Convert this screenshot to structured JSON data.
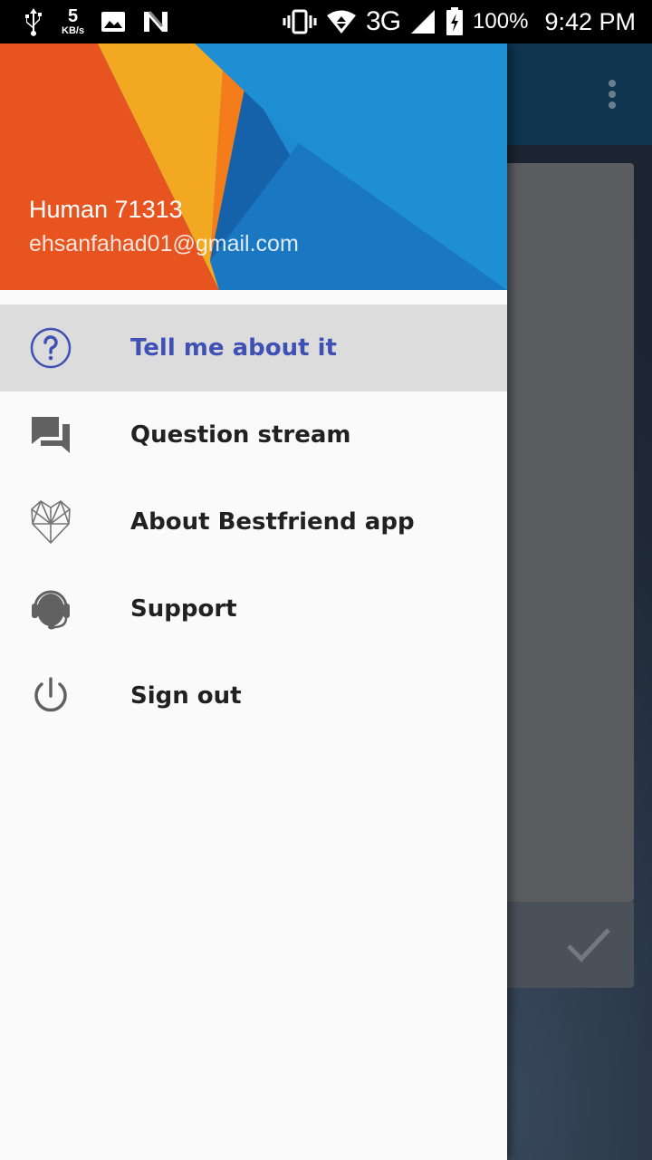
{
  "status_bar": {
    "network_speed_value": "5",
    "network_speed_unit": "KB/s",
    "network_type": "3G",
    "battery_percent": "100%",
    "time": "9:42 PM"
  },
  "drawer": {
    "user": {
      "name": "Human 71313",
      "email": "ehsanfahad01@gmail.com"
    },
    "items": [
      {
        "label": "Tell me about it",
        "icon": "help-circle-icon",
        "active": true
      },
      {
        "label": "Question stream",
        "icon": "forum-icon",
        "active": false
      },
      {
        "label": "About Bestfriend app",
        "icon": "heart-logo-icon",
        "active": false
      },
      {
        "label": "Support",
        "icon": "headset-icon",
        "active": false
      },
      {
        "label": "Sign out",
        "icon": "power-icon",
        "active": false
      }
    ]
  },
  "colors": {
    "active_item_text": "#3f51b5",
    "active_item_background": "#dcdcdc",
    "drawer_background": "#fafafa",
    "status_bar": "#000000"
  }
}
